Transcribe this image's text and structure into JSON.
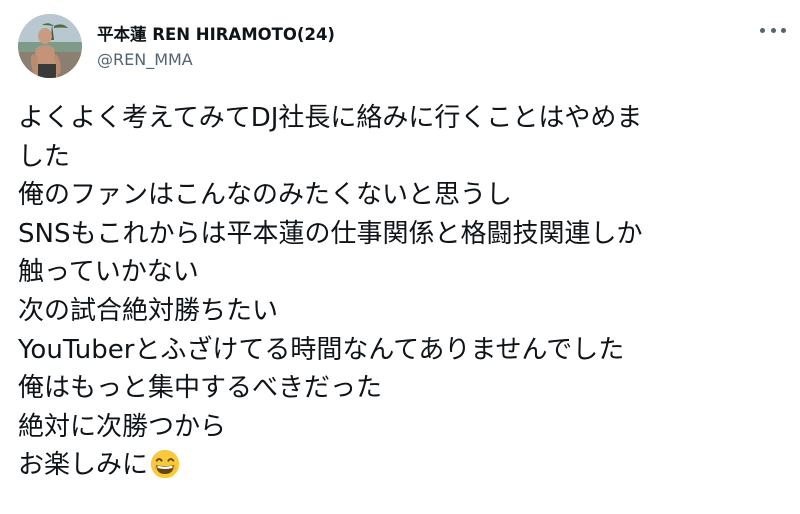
{
  "tweet": {
    "display_name": "平本蓮 REN HIRAMOTO(24)",
    "handle": "@REN_MMA",
    "body_lines": [
      "よくよく考えてみてDJ社長に絡みに行くことはやめま",
      "した",
      "俺のファンはこんなのみたくないと思うし",
      "SNSもこれからは平本蓮の仕事関係と格闘技関連しか",
      "触っていかない",
      "次の試合絶対勝ちたい",
      "YouTuberとふざけてる時間なんてありませんでした",
      "俺はもっと集中するべきだった",
      "絶対に次勝つから",
      "お楽しみに"
    ],
    "emoji": "grinning-face-with-smiling-eyes-icon",
    "more_icon": "more-horizontal-icon"
  },
  "colors": {
    "text": "#0f1419",
    "secondary": "#536471",
    "emoji_yellow": "#f7c93b"
  }
}
